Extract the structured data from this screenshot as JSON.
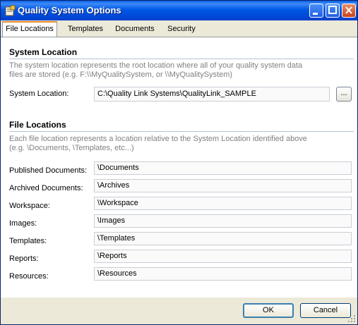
{
  "window": {
    "title": "Quality System Options"
  },
  "tabs": [
    {
      "label": "File Locations"
    },
    {
      "label": "Templates"
    },
    {
      "label": "Documents"
    },
    {
      "label": "Security"
    }
  ],
  "system_location": {
    "heading": "System Location",
    "description_line1": "The system location represents the root location where all of your quality system data",
    "description_line2": "files are stored (e.g. F:\\\\MyQualitySystem, or \\\\MyQualitySystem)",
    "label": "System Location:",
    "value": "C:\\Quality Link Systems\\QualityLink_SAMPLE",
    "browse_label": "..."
  },
  "file_locations": {
    "heading": "File Locations",
    "description_line1": "Each file location represents a location relative to the System Location identified above",
    "description_line2": "(e.g. \\Documents, \\Templates, etc...)",
    "rows": [
      {
        "label": "Published Documents:",
        "value": "\\Documents"
      },
      {
        "label": "Archived Documents:",
        "value": "\\Archives"
      },
      {
        "label": "Workspace:",
        "value": "\\Workspace"
      },
      {
        "label": "Images:",
        "value": "\\Images"
      },
      {
        "label": "Templates:",
        "value": "\\Templates"
      },
      {
        "label": "Reports:",
        "value": "\\Reports"
      },
      {
        "label": "Resources:",
        "value": "\\Resources"
      }
    ]
  },
  "buttons": {
    "ok": "OK",
    "cancel": "Cancel"
  }
}
